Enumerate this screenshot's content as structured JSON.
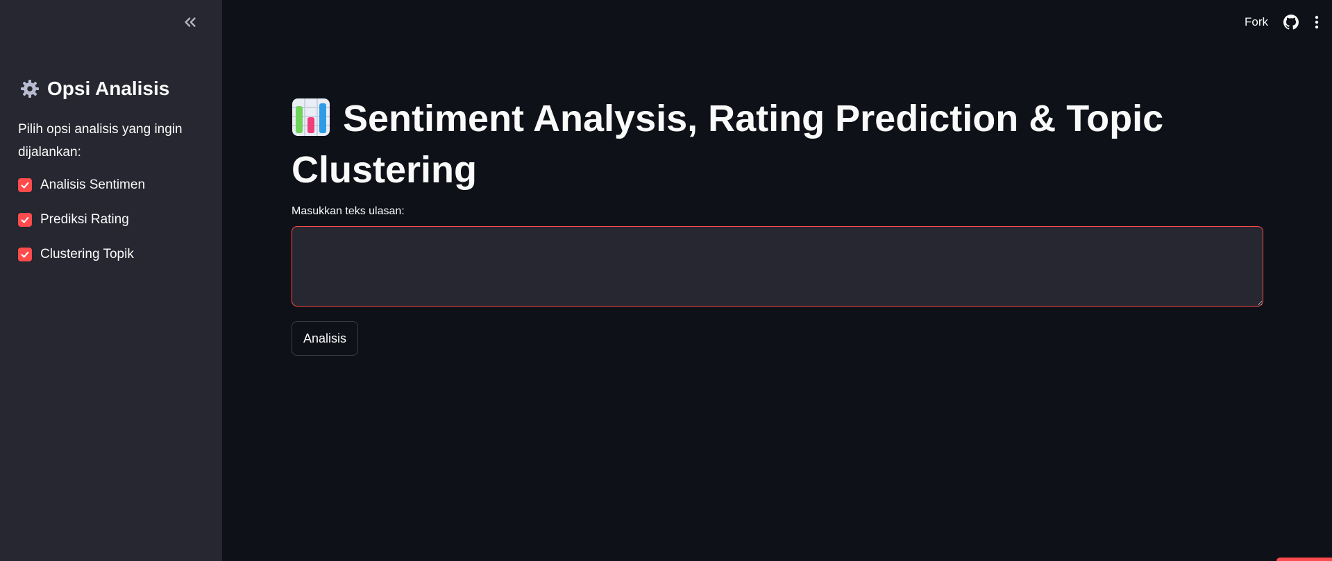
{
  "sidebar": {
    "collapse_icon": "double-chevron-left-icon",
    "title_icon": "gear-icon",
    "title": "Opsi Analisis",
    "description": "Pilih opsi analisis yang ingin dijalankan:",
    "options": [
      {
        "label": "Analisis Sentimen",
        "checked": true
      },
      {
        "label": "Prediksi Rating",
        "checked": true
      },
      {
        "label": "Clustering Topik",
        "checked": true
      }
    ]
  },
  "header": {
    "fork_label": "Fork",
    "github_icon": "github-icon",
    "menu_icon": "kebab-menu-icon"
  },
  "main": {
    "title_icon": "bar-chart-icon",
    "title": "Sentiment Analysis, Rating Prediction & Topic Clustering",
    "input_label": "Masukkan teks ulasan:",
    "input_value": "",
    "button_label": "Analisis"
  },
  "colors": {
    "background": "#0e1117",
    "sidebar": "#262730",
    "accent": "#ff4b4b",
    "text": "#fafafa"
  }
}
